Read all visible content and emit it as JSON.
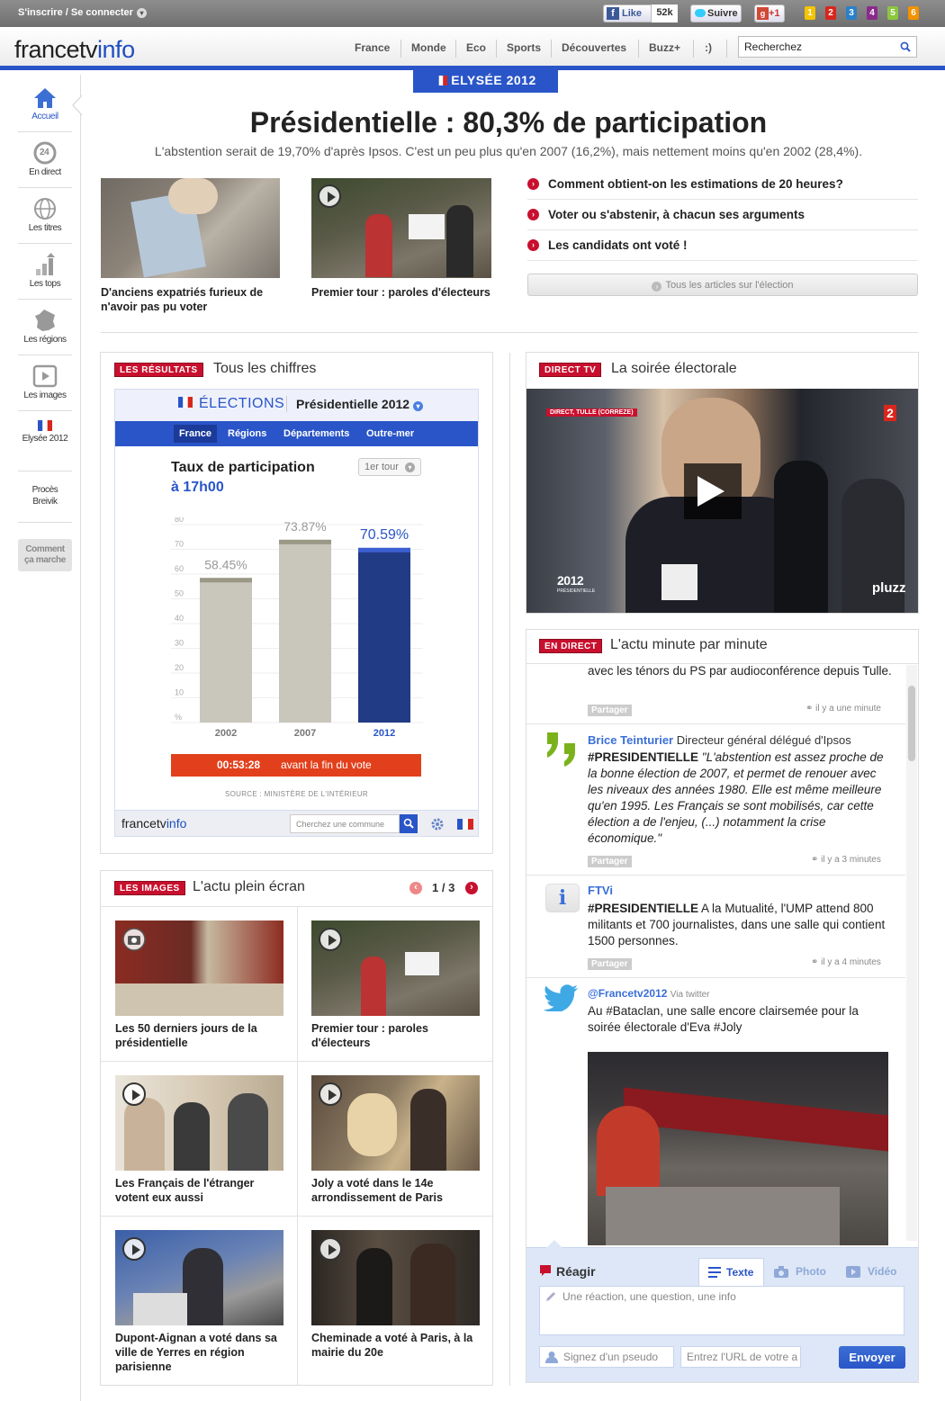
{
  "topbar": {
    "signin": "S'inscrire / Se connecter",
    "like": "Like",
    "like_count": "52k",
    "follow": "Suivre",
    "plusone": "+1",
    "channels": [
      "1",
      "2",
      "3",
      "4",
      "5",
      "6"
    ]
  },
  "header": {
    "logo_a": "francetv",
    "logo_b": "info",
    "nav": [
      "France",
      "Monde",
      "Eco",
      "Sports",
      "Découvertes",
      "Buzz+",
      ":)"
    ],
    "search_placeholder": "Recherchez"
  },
  "sidebar": {
    "items": [
      "Accueil",
      "En direct",
      "Les titres",
      "Les tops",
      "Les régions",
      "Les images",
      "Elysée 2012"
    ],
    "proces": [
      "Procès",
      "Breivik"
    ],
    "comment": [
      "Comment",
      "ça marche"
    ],
    "direct_badge": "24"
  },
  "main": {
    "banner": "ELYSÉE 2012",
    "headline": "Présidentielle : 80,3% de participation",
    "subhead": "L'abstention serait de 19,70% d'après Ipsos. C'est un peu plus qu'en 2007 (16,2%), mais nettement moins qu'en 2002 (28,4%).",
    "stories": [
      "D'anciens expatriés furieux de n'avoir pas pu voter",
      "Premier tour : paroles d'électeurs"
    ],
    "links": [
      "Comment obtient-on les estimations de 20 heures?",
      "Voter ou s'abstenir, à chacun ses arguments",
      "Les candidats ont voté !"
    ],
    "all_articles": "Tous les articles sur l'élection"
  },
  "results": {
    "tag": "LES RÉSULTATS",
    "title": "Tous les chiffres",
    "widget_label": "ÉLECTIONS",
    "widget_select": "Présidentielle 2012",
    "tabs": [
      "France",
      "Régions",
      "Départements",
      "Outre-mer"
    ],
    "chart_title": "Taux de participation",
    "chart_subtitle": "à 17h00",
    "round_select": "1er tour",
    "countdown": "00:53:28",
    "countdown_label": "avant la fin du vote",
    "source": "SOURCE : MINISTÈRE DE L'INTÉRIEUR",
    "footer_logo_a": "francetv",
    "footer_logo_b": "info",
    "commune_placeholder": "Cherchez une commune"
  },
  "chart_data": {
    "type": "bar",
    "title": "Taux de participation",
    "subtitle": "à 17h00",
    "categories": [
      "2002",
      "2007",
      "2012"
    ],
    "values": [
      58.45,
      73.87,
      70.59
    ],
    "value_labels": [
      "58.45%",
      "73.87%",
      "70.59%"
    ],
    "yticks": [
      "%",
      "10",
      "20",
      "30",
      "40",
      "50",
      "60",
      "70",
      "80"
    ],
    "ylim": [
      0,
      80
    ],
    "colors": [
      "#c9c6bb",
      "#c9c6bb",
      "#213b84"
    ],
    "grid": true
  },
  "images": {
    "tag": "LES IMAGES",
    "title": "L'actu plein écran",
    "pager": "1 / 3",
    "items": [
      "Les 50 derniers jours de la présidentielle",
      "Premier tour : paroles d'électeurs",
      "Les Français de l'étranger votent eux aussi",
      "Joly a voté dans le 14e arrondissement de Paris",
      "Dupont-Aignan a voté dans sa ville de Yerres en région parisienne",
      "Cheminade a voté à Paris, à la mairie du 20e"
    ]
  },
  "directtv": {
    "tag": "DIRECT TV",
    "title": "La soirée électorale",
    "lower_third": "DIRECT, TULLE (CORREZE)",
    "channel": "2",
    "corner_logo": "2012",
    "corner_logo_sub": "PRÉSIDENTIELLE",
    "brand": "pluzz"
  },
  "live": {
    "tag": "EN DIRECT",
    "title": "L'actu minute par minute",
    "share_label": "Partager",
    "entries": [
      {
        "name": "",
        "role": "",
        "text": "avec les ténors du PS par audioconférence depuis Tulle.",
        "time": "il y a une minute"
      },
      {
        "name": "Brice Teinturier",
        "role": "Directeur général délégué d'Ipsos",
        "hashtag": "#PRESIDENTIELLE",
        "text": "\"L'abstention est assez proche de la bonne élection de 2007, et permet de renouer avec les niveaux des années 1980. Elle est même meilleure qu'en 1995. Les Français se sont mobilisés, car cette élection a de l'enjeu, (...) notamment la crise économique.\"",
        "time": "il y a 3 minutes"
      },
      {
        "name": "FTVi",
        "role": "",
        "hashtag": "#PRESIDENTIELLE",
        "text": "A la Mutualité, l'UMP attend 800 militants et 700 journalistes, dans une salle qui contient 1500 personnes.",
        "time": "il y a 4 minutes"
      },
      {
        "name": "@Francetv2012",
        "role": "Via twitter",
        "text": "Au #Bataclan, une salle encore clairsemée pour la soirée électorale d'Eva #Joly",
        "time": ""
      }
    ],
    "react": {
      "title": "Réagir",
      "tabs": [
        "Texte",
        "Photo",
        "Vidéo"
      ],
      "placeholder": "Une réaction, une question, une info",
      "pseudo_placeholder": "Signez d'un pseudo",
      "url_placeholder": "Entrez l'URL de votre a",
      "submit": "Envoyer"
    }
  },
  "colors": {
    "accent": "#2a55c8",
    "red": "#c8102e",
    "navy": "#213b84"
  }
}
